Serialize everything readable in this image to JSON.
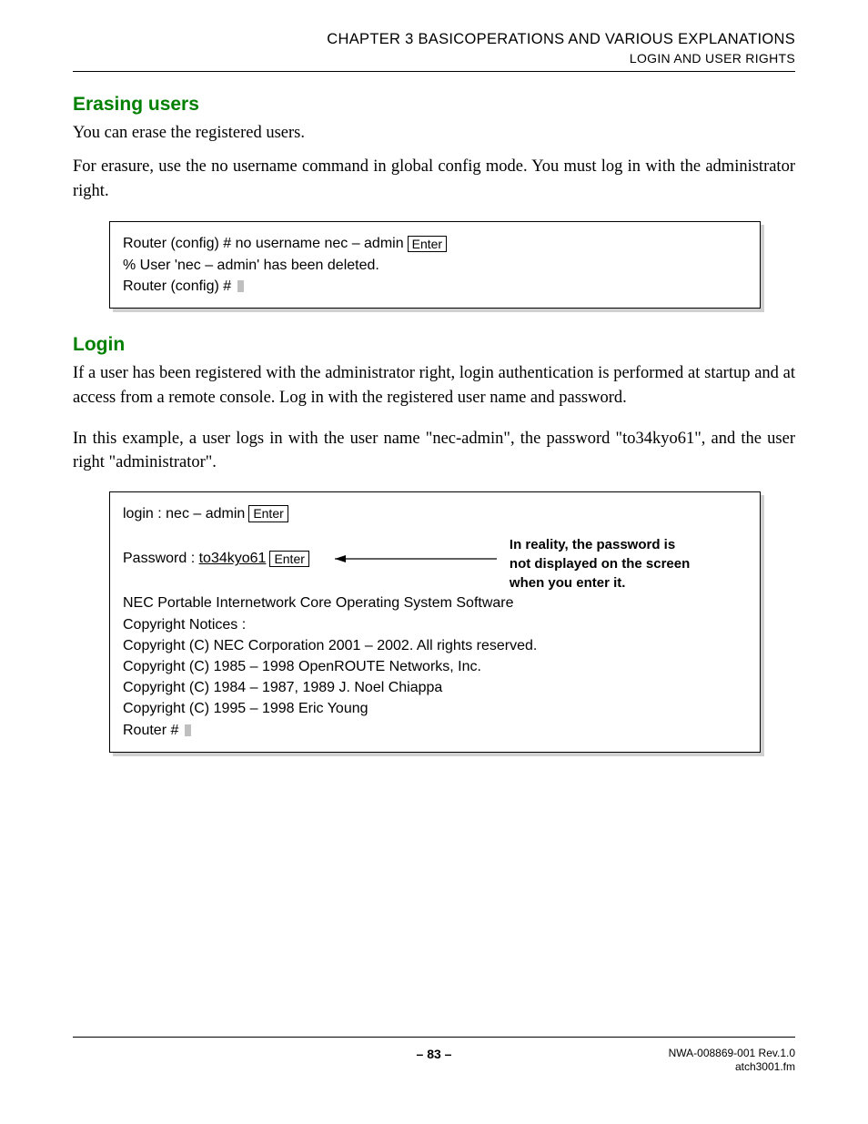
{
  "header": {
    "chapter": "CHAPTER 3   BASICOPERATIONS AND VARIOUS EXPLANATIONS",
    "section": "LOGIN AND USER RIGHTS"
  },
  "s1": {
    "title": "Erasing users",
    "p1": "You can erase the registered users.",
    "p2": "For erasure, use the no username command in global config mode. You must log in with the administrator right."
  },
  "code1": {
    "l1": "Router (config) # no username nec – admin",
    "k1": "Enter",
    "l2": "% User 'nec – admin' has been deleted.",
    "l3": "Router (config) # "
  },
  "s2": {
    "title": "Login",
    "p1": "If a user has been registered with the administrator right, login authentication is performed at startup and at access from a remote console. Log in with the registered user name and password.",
    "p2": "In this example, a user logs in with the user name \"nec-admin\", the password \"to34kyo61\", and the user right \"administrator\"."
  },
  "code2": {
    "l1a": "login : nec – admin",
    "k1": "Enter",
    "l2a": "Password : ",
    "l2b": "to34kyo61",
    "k2": "Enter",
    "l3": "NEC Portable Internetwork Core Operating System Software",
    "l4": "Copyright Notices :",
    "l5": "Copyright (C) NEC Corporation 2001 – 2002. All rights reserved.",
    "l6": "Copyright (C) 1985 – 1998 OpenROUTE Networks, Inc.",
    "l7": "Copyright (C) 1984 – 1987, 1989 J. Noel Chiappa",
    "l8": "Copyright (C) 1995 – 1998 Eric Young",
    "l9": "Router # "
  },
  "annot": {
    "l1": "In reality, the password is",
    "l2": "not displayed on the screen",
    "l3": "when you enter it."
  },
  "footer": {
    "page": "– 83 –",
    "doc": "NWA-008869-001 Rev.1.0",
    "file": "atch3001.fm"
  }
}
